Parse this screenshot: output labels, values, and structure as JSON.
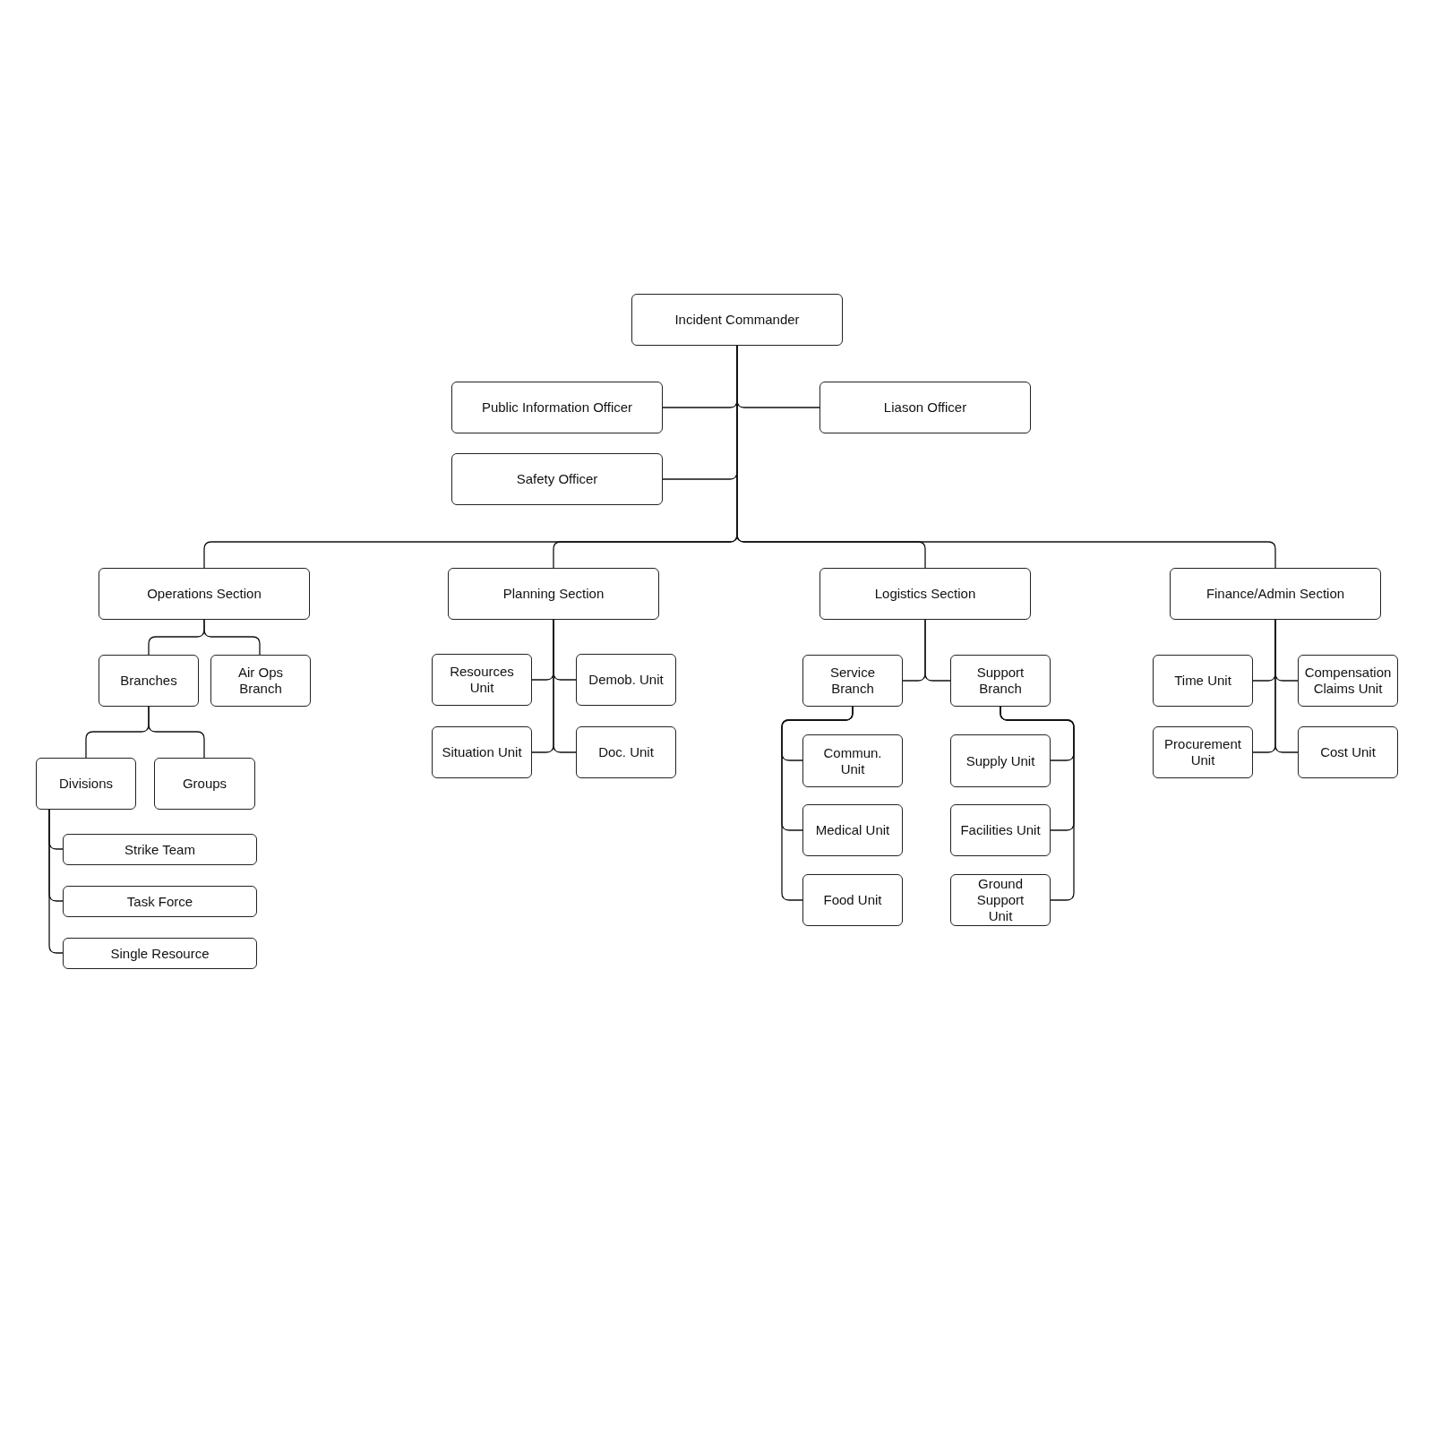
{
  "org_chart": {
    "label": "Incident Commander",
    "children": [
      {
        "label": "Public Information Officer"
      },
      {
        "label": "Liason Officer"
      },
      {
        "label": "Safety Officer"
      },
      {
        "label": "Operations Section",
        "children": [
          {
            "label": "Branches",
            "children": [
              {
                "label": "Divisions",
                "children": [
                  {
                    "label": "Strike Team"
                  },
                  {
                    "label": "Task Force"
                  },
                  {
                    "label": "Single Resource"
                  }
                ]
              },
              {
                "label": "Groups"
              }
            ]
          },
          {
            "label": "Air Ops Branch"
          }
        ]
      },
      {
        "label": "Planning Section",
        "children": [
          {
            "label": "Resources Unit"
          },
          {
            "label": "Demob. Unit"
          },
          {
            "label": "Situation Unit"
          },
          {
            "label": "Doc. Unit"
          }
        ]
      },
      {
        "label": "Logistics Section",
        "children": [
          {
            "label": "Service Branch",
            "children": [
              {
                "label": "Commun. Unit"
              },
              {
                "label": "Medical Unit"
              },
              {
                "label": "Food Unit"
              }
            ]
          },
          {
            "label": "Support Branch",
            "children": [
              {
                "label": "Supply Unit"
              },
              {
                "label": "Facilities Unit"
              },
              {
                "label": "Ground Support Unit"
              }
            ]
          }
        ]
      },
      {
        "label": "Finance/Admin Section",
        "children": [
          {
            "label": "Time Unit"
          },
          {
            "label": "Compensation Claims Unit"
          },
          {
            "label": "Procurement Unit"
          },
          {
            "label": "Cost Unit"
          }
        ]
      }
    ]
  }
}
